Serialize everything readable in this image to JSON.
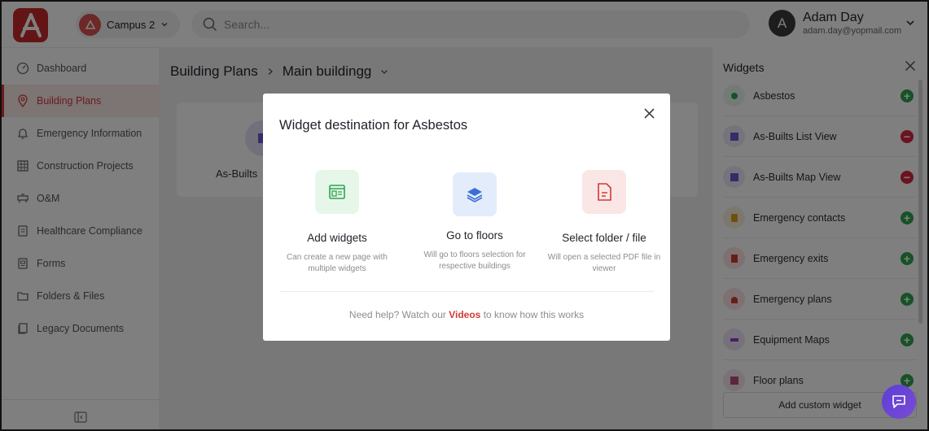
{
  "header": {
    "campus_label": "Campus 2",
    "search_placeholder": "Search...",
    "user_initial": "A",
    "user_name": "Adam Day",
    "user_email": "adam.day@yopmail.com"
  },
  "sidebar": {
    "items": [
      {
        "label": "Dashboard",
        "icon": "gauge-icon"
      },
      {
        "label": "Building Plans",
        "icon": "location-pin-icon"
      },
      {
        "label": "Emergency Information",
        "icon": "bell-icon"
      },
      {
        "label": "Construction Projects",
        "icon": "grid-icon"
      },
      {
        "label": "O&M",
        "icon": "toolbox-icon"
      },
      {
        "label": "Healthcare Compliance",
        "icon": "clipboard-icon"
      },
      {
        "label": "Forms",
        "icon": "form-icon"
      },
      {
        "label": "Folders & Files",
        "icon": "folder-icon"
      },
      {
        "label": "Legacy Documents",
        "icon": "documents-icon"
      }
    ]
  },
  "main": {
    "breadcrumb": {
      "root": "Building Plans",
      "current": "Main buildingg"
    },
    "card_label": "As-Builts"
  },
  "panel": {
    "title": "Widgets",
    "widgets": [
      {
        "label": "Asbestos",
        "action": "add",
        "color": "#2ea44f"
      },
      {
        "label": "As-Builts List View",
        "action": "remove",
        "color": "#6b5bd1"
      },
      {
        "label": "As-Builts Map View",
        "action": "remove",
        "color": "#6b5bd1"
      },
      {
        "label": "Emergency contacts",
        "action": "add",
        "color": "#e0a020"
      },
      {
        "label": "Emergency exits",
        "action": "add",
        "color": "#d33a34"
      },
      {
        "label": "Emergency plans",
        "action": "add",
        "color": "#d33a34"
      },
      {
        "label": "Equipment Maps",
        "action": "add",
        "color": "#8a3fd0"
      },
      {
        "label": "Floor plans",
        "action": "add",
        "color": "#b0507a"
      }
    ],
    "custom_button": "Add custom widget"
  },
  "modal": {
    "title": "Widget destination for Asbestos",
    "options": [
      {
        "title": "Add widgets",
        "desc": "Can create a new page with multiple widgets"
      },
      {
        "title": "Go to floors",
        "desc": "Will go to floors selection for respective buildings"
      },
      {
        "title": "Select folder / file",
        "desc": "Will open a selected PDF file in viewer"
      }
    ],
    "help_prefix": "Need help? Watch our ",
    "help_link": "Videos",
    "help_suffix": " to know how this works"
  }
}
